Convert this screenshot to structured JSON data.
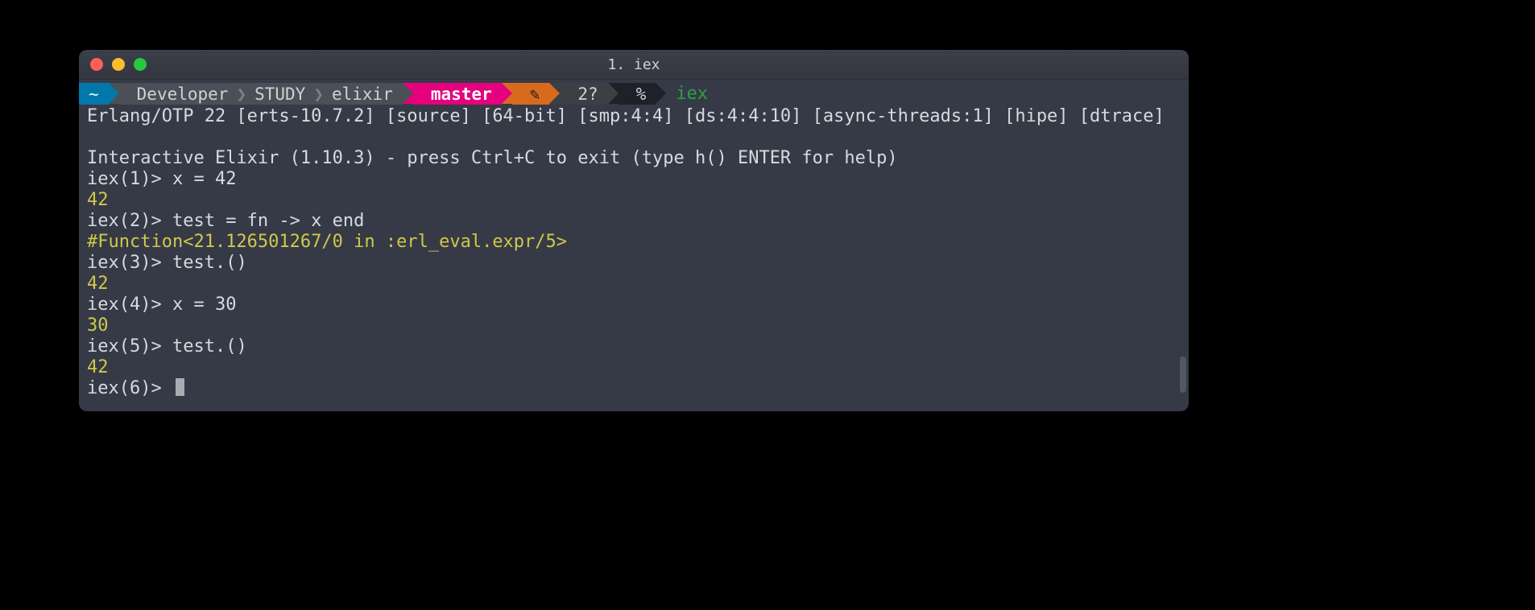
{
  "window": {
    "title": "1. iex"
  },
  "powerline": {
    "home": "~",
    "path": [
      "Developer",
      "STUDY",
      "elixir"
    ],
    "branch": "master",
    "dirty_icon": "✎",
    "stash": "2?",
    "symbol": "%",
    "command": "iex"
  },
  "session": {
    "banner": "Erlang/OTP 22 [erts-10.7.2] [source] [64-bit] [smp:4:4] [ds:4:4:10] [async-threads:1] [hipe] [dtrace]",
    "intro": "Interactive Elixir (1.10.3) - press Ctrl+C to exit (type h() ENTER for help)",
    "lines": [
      {
        "prompt": "iex(1)> ",
        "input": "x = 42"
      },
      {
        "output": "42"
      },
      {
        "prompt": "iex(2)> ",
        "input": "test = fn -> x end"
      },
      {
        "output": "#Function<21.126501267/0 in :erl_eval.expr/5>"
      },
      {
        "prompt": "iex(3)> ",
        "input": "test.()"
      },
      {
        "output": "42"
      },
      {
        "prompt": "iex(4)> ",
        "input": "x = 30"
      },
      {
        "output": "30"
      },
      {
        "prompt": "iex(5)> ",
        "input": "test.()"
      },
      {
        "output": "42"
      },
      {
        "prompt": "iex(6)> ",
        "cursor": true
      }
    ]
  }
}
